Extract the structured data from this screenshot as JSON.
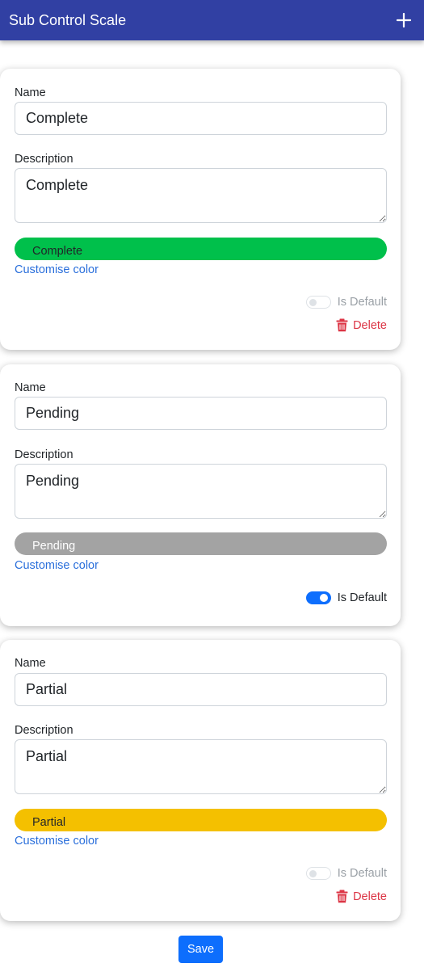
{
  "appbar": {
    "title": "Sub Control Scale",
    "add_icon": "plus-icon"
  },
  "labels": {
    "name": "Name",
    "description": "Description",
    "customise": "Customise color",
    "is_default": "Is Default",
    "delete": "Delete"
  },
  "scales": [
    {
      "name": "Complete",
      "description": "Complete",
      "color_label": "Complete",
      "color": "#00c04b",
      "is_default": false
    },
    {
      "name": "Pending",
      "description": "Pending",
      "color_label": "Pending",
      "color": "#a3a3a3",
      "is_default": true
    },
    {
      "name": "Partial",
      "description": "Partial",
      "color_label": "Partial",
      "color": "#f4c000",
      "is_default": false
    }
  ],
  "footer": {
    "save_label": "Save"
  },
  "icons": {
    "delete": "trash-icon"
  },
  "colors": {
    "accent": "#0d6efd",
    "appbar": "#3140a3",
    "danger": "#dc3545",
    "link": "#2a6fdb"
  }
}
